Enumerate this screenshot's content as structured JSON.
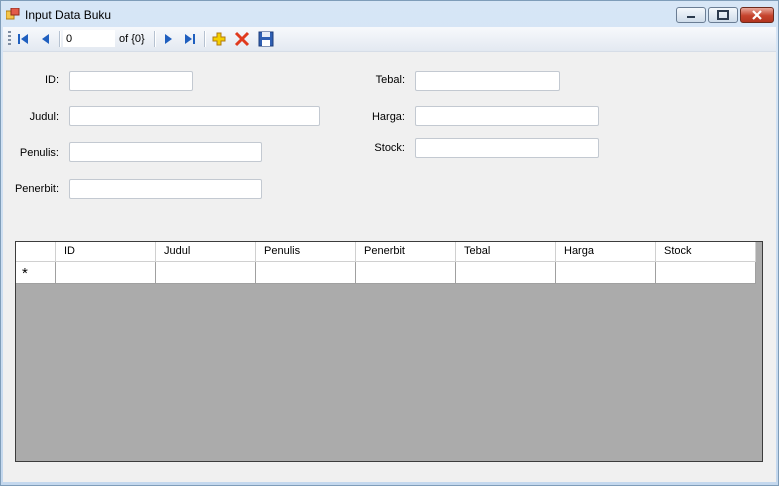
{
  "window": {
    "title": "Input Data Buku"
  },
  "navigator": {
    "position": "0",
    "count_label": "of {0}"
  },
  "fields": {
    "id": {
      "label": "ID:",
      "value": ""
    },
    "judul": {
      "label": "Judul:",
      "value": ""
    },
    "penulis": {
      "label": "Penulis:",
      "value": ""
    },
    "penerbit": {
      "label": "Penerbit:",
      "value": ""
    },
    "tebal": {
      "label": "Tebal:",
      "value": ""
    },
    "harga": {
      "label": "Harga:",
      "value": ""
    },
    "stock": {
      "label": "Stock:",
      "value": ""
    }
  },
  "grid": {
    "columns": [
      "ID",
      "Judul",
      "Penulis",
      "Penerbit",
      "Tebal",
      "Harga",
      "Stock"
    ],
    "new_row_marker": "*"
  },
  "colors": {
    "nav_blue": "#1f5fbf",
    "add_yellow": "#e6b800",
    "delete_red": "#e03a1e",
    "grid_bg": "#ababab"
  },
  "icons": [
    "move-first-icon",
    "move-previous-icon",
    "move-next-icon",
    "move-last-icon",
    "add-new-icon",
    "delete-icon",
    "save-icon"
  ]
}
